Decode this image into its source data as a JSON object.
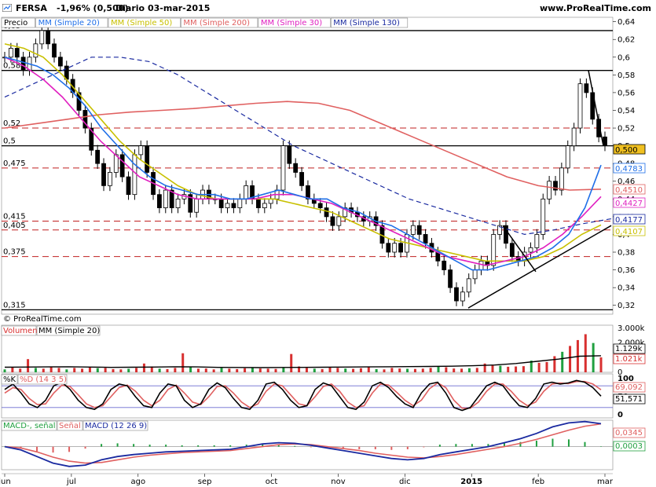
{
  "header": {
    "symbol": "FERSA",
    "change": "-1,96% (0,500)",
    "period": "Diario",
    "date": "03-mar-2015",
    "site": "www.ProRealTime.com",
    "copyright": "© ProRealTime.com"
  },
  "colors": {
    "candle": "#000000",
    "ma20": "#1f6fe8",
    "ma50": "#c8c000",
    "ma200": "#e06060",
    "ma30": "#e020c0",
    "ma130": "#1a2aa0",
    "volume": "#d83030",
    "stoch_k": "#000000",
    "stoch_d": "#e06060",
    "macd": "#1a2aa0",
    "signal": "#e06060",
    "hist": "#20a040"
  },
  "chart_data": [
    {
      "type": "candlestick",
      "title": "FERSA",
      "legend": [
        "Precio",
        "MM (Simple 20)",
        "MM (Simple 50)",
        "MM (Simple 200)",
        "MM (Simple 30)",
        "MM (Simple 130)"
      ],
      "x_ticks": [
        "jun",
        "jul",
        "ago",
        "sep",
        "oct",
        "nov",
        "dic",
        "2015",
        "feb",
        "mar"
      ],
      "y_ticks": [
        "0,64",
        "0,62",
        "0,6",
        "0,58",
        "0,56",
        "0,54",
        "0,52",
        "0,5",
        "0,48",
        "0,46",
        "0,44",
        "0,42",
        "0,4",
        "0,38",
        "0,36",
        "0,34",
        "0,32"
      ],
      "ylim": [
        0.31,
        0.645
      ],
      "horizontal_levels": [
        {
          "value": 0.63,
          "label": "0,63",
          "style": "solid"
        },
        {
          "value": 0.585,
          "label": "0,585",
          "style": "solid"
        },
        {
          "value": 0.52,
          "label": "0,52",
          "style": "dashed"
        },
        {
          "value": 0.5,
          "label": "0,5",
          "style": "solid"
        },
        {
          "value": 0.475,
          "label": "0,475",
          "style": "dashed"
        },
        {
          "value": 0.415,
          "label": "0,415",
          "style": "dashed"
        },
        {
          "value": 0.405,
          "label": "0,405",
          "style": "dashed"
        },
        {
          "value": 0.375,
          "label": "0,375",
          "style": "dashed"
        },
        {
          "value": 0.315,
          "label": "0,315",
          "style": "solid"
        }
      ],
      "last_values": [
        {
          "label": "0,500",
          "series": "Precio"
        },
        {
          "label": "0,4783",
          "series": "MM (Simple 20)"
        },
        {
          "label": "0,4510",
          "series": "MM (Simple 200)"
        },
        {
          "label": "0,4427",
          "series": "MM (Simple 30)"
        },
        {
          "label": "0,4177",
          "series": "MM (Simple 130)"
        },
        {
          "label": "0,4107",
          "series": "MM (Simple 50)"
        }
      ],
      "close_path": [
        0.6,
        0.61,
        0.6,
        0.585,
        0.6,
        0.615,
        0.63,
        0.615,
        0.6,
        0.59,
        0.575,
        0.56,
        0.54,
        0.52,
        0.495,
        0.48,
        0.455,
        0.47,
        0.49,
        0.465,
        0.445,
        0.49,
        0.5,
        0.47,
        0.445,
        0.43,
        0.45,
        0.43,
        0.44,
        0.445,
        0.425,
        0.44,
        0.45,
        0.44,
        0.44,
        0.43,
        0.435,
        0.43,
        0.44,
        0.455,
        0.44,
        0.43,
        0.435,
        0.44,
        0.45,
        0.5,
        0.48,
        0.47,
        0.455,
        0.44,
        0.435,
        0.43,
        0.42,
        0.41,
        0.42,
        0.43,
        0.425,
        0.42,
        0.415,
        0.42,
        0.41,
        0.39,
        0.38,
        0.39,
        0.38,
        0.4,
        0.41,
        0.4,
        0.39,
        0.38,
        0.37,
        0.36,
        0.34,
        0.325,
        0.335,
        0.35,
        0.36,
        0.37,
        0.365,
        0.4,
        0.41,
        0.39,
        0.375,
        0.37,
        0.38,
        0.385,
        0.4,
        0.44,
        0.46,
        0.45,
        0.475,
        0.5,
        0.52,
        0.57,
        0.56,
        0.53,
        0.51,
        0.5
      ],
      "ma20": [
        0.6,
        0.595,
        0.59,
        0.58,
        0.565,
        0.545,
        0.52,
        0.5,
        0.48,
        0.465,
        0.455,
        0.45,
        0.445,
        0.445,
        0.44,
        0.44,
        0.445,
        0.45,
        0.445,
        0.44,
        0.44,
        0.43,
        0.425,
        0.415,
        0.41,
        0.4,
        0.39,
        0.38,
        0.37,
        0.36,
        0.36,
        0.365,
        0.37,
        0.375,
        0.385,
        0.4,
        0.43,
        0.4783
      ],
      "ma50": [
        0.615,
        0.61,
        0.6,
        0.58,
        0.555,
        0.53,
        0.505,
        0.485,
        0.47,
        0.455,
        0.445,
        0.44,
        0.44,
        0.44,
        0.44,
        0.435,
        0.43,
        0.425,
        0.415,
        0.405,
        0.395,
        0.39,
        0.385,
        0.38,
        0.375,
        0.37,
        0.37,
        0.37,
        0.375,
        0.385,
        0.4,
        0.4107
      ],
      "ma200": [
        0.52,
        0.525,
        0.53,
        0.535,
        0.538,
        0.54,
        0.542,
        0.545,
        0.548,
        0.55,
        0.548,
        0.54,
        0.525,
        0.51,
        0.495,
        0.48,
        0.465,
        0.455,
        0.45,
        0.451
      ],
      "ma30": [
        0.6,
        0.59,
        0.575,
        0.555,
        0.53,
        0.505,
        0.485,
        0.465,
        0.455,
        0.445,
        0.44,
        0.44,
        0.44,
        0.44,
        0.445,
        0.445,
        0.44,
        0.435,
        0.425,
        0.415,
        0.405,
        0.395,
        0.385,
        0.375,
        0.37,
        0.365,
        0.37,
        0.375,
        0.385,
        0.4,
        0.42,
        0.4427
      ],
      "ma130": [
        0.555,
        0.57,
        0.585,
        0.6,
        0.6,
        0.595,
        0.58,
        0.56,
        0.54,
        0.52,
        0.5,
        0.485,
        0.47,
        0.455,
        0.44,
        0.43,
        0.42,
        0.41,
        0.4,
        0.405,
        0.412,
        0.4177
      ]
    },
    {
      "type": "bar",
      "title": "Volumen",
      "legend": [
        "Volumen",
        "MM (Simple 20)"
      ],
      "y_ticks": [
        "3.000k",
        "2.000k",
        "1.000k",
        "0"
      ],
      "last_values": [
        "1.129k",
        "1.021k"
      ],
      "values_k": [
        200,
        350,
        250,
        900,
        300,
        250,
        400,
        300,
        200,
        300,
        250,
        350,
        280,
        300,
        220,
        200,
        240,
        300,
        600,
        400,
        250,
        220,
        300,
        1300,
        350,
        250,
        260,
        200,
        300,
        250,
        220,
        280,
        350,
        260,
        250,
        230,
        300,
        1250,
        400,
        300,
        250,
        220,
        350,
        300,
        260,
        240,
        280,
        350,
        220,
        200,
        300,
        260,
        240,
        230,
        250,
        300,
        400,
        350,
        260,
        250,
        280,
        300,
        600,
        500,
        450,
        380,
        400,
        420,
        800,
        650,
        700,
        1100,
        1400,
        1800,
        2200,
        2600,
        2000,
        1021
      ],
      "ma_k": [
        350,
        360,
        370,
        380,
        360,
        340,
        350,
        360,
        380,
        370,
        340,
        330,
        320,
        330,
        340,
        350,
        360,
        370,
        380,
        390,
        400,
        420,
        450,
        500,
        600,
        750,
        900,
        1100,
        1129
      ],
      "ylim": [
        0,
        3000
      ]
    },
    {
      "type": "line",
      "title": "%K %D (14 3 5)",
      "legend": [
        "%K",
        "%D (14 3 5)"
      ],
      "y_ticks": [
        "100",
        "50",
        "0"
      ],
      "last_values": [
        "69,092",
        "51,571"
      ],
      "k": [
        70,
        85,
        60,
        30,
        20,
        40,
        80,
        90,
        70,
        40,
        20,
        15,
        30,
        70,
        85,
        80,
        50,
        25,
        20,
        60,
        85,
        80,
        40,
        20,
        30,
        70,
        88,
        75,
        45,
        20,
        15,
        40,
        85,
        90,
        70,
        40,
        20,
        25,
        70,
        88,
        80,
        50,
        20,
        15,
        35,
        80,
        90,
        75,
        50,
        30,
        20,
        60,
        85,
        90,
        60,
        20,
        12,
        20,
        50,
        80,
        90,
        80,
        50,
        25,
        20,
        45,
        85,
        90,
        85,
        88,
        95,
        90,
        75,
        51.571
      ],
      "d": [
        60,
        75,
        70,
        45,
        28,
        30,
        60,
        82,
        78,
        55,
        30,
        20,
        25,
        50,
        75,
        82,
        65,
        40,
        25,
        40,
        70,
        82,
        60,
        35,
        28,
        50,
        78,
        80,
        60,
        35,
        20,
        30,
        65,
        85,
        80,
        55,
        30,
        25,
        50,
        78,
        85,
        65,
        35,
        20,
        25,
        60,
        85,
        82,
        62,
        40,
        25,
        40,
        72,
        88,
        75,
        40,
        18,
        18,
        35,
        65,
        85,
        85,
        65,
        40,
        25,
        35,
        65,
        85,
        88,
        86,
        92,
        92,
        85,
        69.092
      ],
      "ylim": [
        0,
        100
      ]
    },
    {
      "type": "line",
      "title": "MACD",
      "legend": [
        "MACD-, señal",
        "Señal",
        "MACD (12 26 9)"
      ],
      "last_values": [
        "0,0345",
        "0,0003"
      ],
      "macd": [
        0.0,
        -0.005,
        -0.015,
        -0.025,
        -0.03,
        -0.028,
        -0.02,
        -0.015,
        -0.012,
        -0.01,
        -0.008,
        -0.007,
        -0.006,
        -0.005,
        -0.004,
        0.0,
        0.004,
        0.006,
        0.005,
        0.002,
        -0.002,
        -0.006,
        -0.01,
        -0.014,
        -0.018,
        -0.02,
        -0.018,
        -0.012,
        -0.008,
        -0.004,
        0.0,
        0.006,
        0.012,
        0.02,
        0.03,
        0.036,
        0.038,
        0.0348
      ],
      "signal": [
        0.0,
        -0.002,
        -0.008,
        -0.016,
        -0.022,
        -0.025,
        -0.024,
        -0.02,
        -0.016,
        -0.013,
        -0.011,
        -0.009,
        -0.008,
        -0.007,
        -0.006,
        -0.003,
        0.0,
        0.003,
        0.004,
        0.003,
        0.0,
        -0.003,
        -0.006,
        -0.01,
        -0.013,
        -0.016,
        -0.017,
        -0.015,
        -0.012,
        -0.008,
        -0.004,
        0.0,
        0.005,
        0.011,
        0.018,
        0.025,
        0.031,
        0.0345
      ],
      "hist": [
        0.0,
        -0.003,
        -0.007,
        -0.009,
        -0.008,
        -0.003,
        0.004,
        0.005,
        0.004,
        0.003,
        0.003,
        0.002,
        0.002,
        0.002,
        0.002,
        0.003,
        0.004,
        0.003,
        0.001,
        -0.001,
        -0.002,
        -0.003,
        -0.004,
        -0.004,
        -0.005,
        -0.004,
        -0.001,
        0.003,
        0.004,
        0.004,
        0.004,
        0.006,
        0.007,
        0.009,
        0.012,
        0.011,
        0.007,
        0.0003
      ],
      "ylim": [
        -0.035,
        0.04
      ]
    }
  ]
}
